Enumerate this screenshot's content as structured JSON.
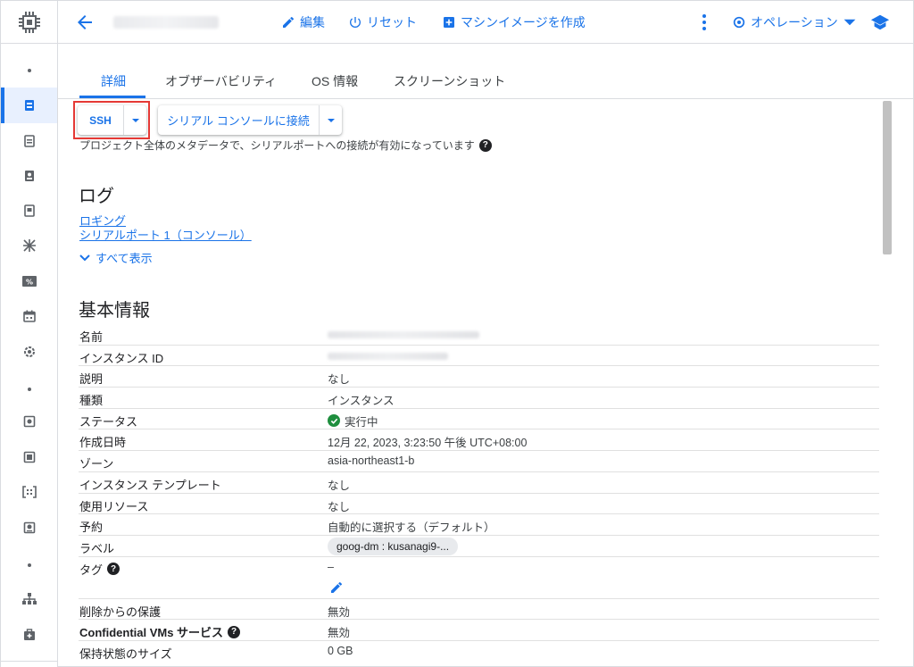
{
  "toolbar": {
    "edit_label": "編集",
    "reset_label": "リセット",
    "create_image_label": "マシンイメージを作成",
    "operations_label": "オペレーション"
  },
  "tabs": [
    {
      "label": "詳細",
      "active": true
    },
    {
      "label": "オブザーバビリティ"
    },
    {
      "label": "OS 情報"
    },
    {
      "label": "スクリーンショット"
    }
  ],
  "connect": {
    "ssh_label": "SSH",
    "serial_label": "シリアル コンソールに接続",
    "note": "プロジェクト全体のメタデータで、シリアルポートへの接続が有効になっています"
  },
  "logs": {
    "heading": "ログ",
    "links": [
      "ロギング",
      "シリアルポート 1（コンソール）"
    ],
    "show_all": "すべて表示"
  },
  "basic_info": {
    "heading": "基本情報",
    "rows": [
      {
        "key": "名前",
        "value": ""
      },
      {
        "key": "インスタンス ID",
        "value": ""
      },
      {
        "key": "説明",
        "value": "なし"
      },
      {
        "key": "種類",
        "value": "インスタンス"
      },
      {
        "key": "ステータス",
        "value": "実行中"
      },
      {
        "key": "作成日時",
        "value": "12月 22, 2023, 3:23:50 午後 UTC+08:00"
      },
      {
        "key": "ゾーン",
        "value": "asia-northeast1-b"
      },
      {
        "key": "インスタンス テンプレート",
        "value": "なし"
      },
      {
        "key": "使用リソース",
        "value": "なし"
      },
      {
        "key": "予約",
        "value": "自動的に選択する（デフォルト）"
      },
      {
        "key": "ラベル",
        "value": "goog-dm : kusanagi9-..."
      },
      {
        "key": "タグ",
        "value": "–"
      },
      {
        "key": "削除からの保護",
        "value": "無効"
      },
      {
        "key": "Confidential VMs サービス",
        "value": "無効"
      },
      {
        "key": "保持状態のサイズ",
        "value": "0 GB"
      }
    ]
  },
  "colors": {
    "accent": "#1a73e8",
    "status_ok": "#1e8e3e",
    "highlight": "#e53935"
  }
}
